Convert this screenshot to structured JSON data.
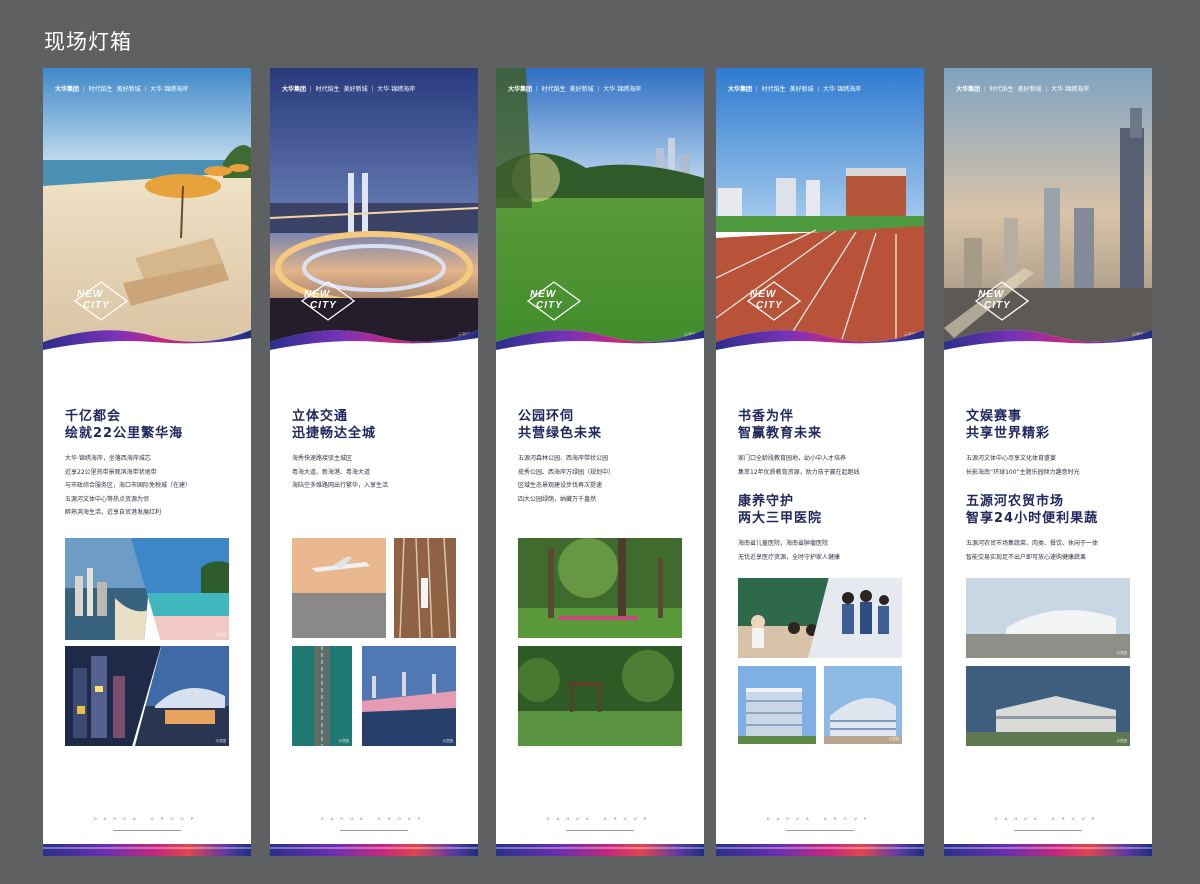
{
  "page": {
    "title": "现场灯箱"
  },
  "brand": {
    "logo_text": "大华集团",
    "logo_sub": "DAHUA GROUP",
    "slogan_1": "时代焰生",
    "slogan_2": "美好新城",
    "project": "大华·锦绣海岸",
    "newcity": [
      "NEW",
      "CITY"
    ],
    "footer": "DAHUA GROUP"
  },
  "panels": [
    {
      "headings": [
        {
          "title": [
            "千亿都会",
            "绘就22公里繁华海"
          ],
          "lines": [
            "大华·锦绣海岸，坐落西海岸城芯",
            "近享22公里热带景观滨海带状地带",
            "与市政综合服务区，海口市国际免税城（在建）",
            "五源河文体中心等热点资源为邻",
            "醉熟滨海生活，近享自贸港发展红利"
          ]
        }
      ]
    },
    {
      "headings": [
        {
          "title": [
            "立体交通",
            "迅捷畅达全城"
          ],
          "lines": [
            "海秀快速路接驳主城区",
            "粤海大道、新海港、粤海大道",
            "海陆空多维路网出行繁华，入享生活"
          ]
        }
      ]
    },
    {
      "headings": [
        {
          "title": [
            "公园环伺",
            "共营绿色未来"
          ],
          "lines": [
            "五源河森林公园、西海岸带状公园",
            "揽秀公园、西海岸万绿园（规划中）",
            "区域生态景观建设步伐再次提速",
            "四大公园绿荫，纳藏万千盎然"
          ]
        }
      ]
    },
    {
      "headings": [
        {
          "title": [
            "书香为伴",
            "智赢教育未来"
          ],
          "lines": [
            "家门口全龄段教育园地，幼小中入才培养",
            "集萃12年优质教育资源，助力孩子赢在起跑线"
          ]
        },
        {
          "title": [
            "康养守护",
            "两大三甲医院"
          ],
          "lines": [
            "海南省儿童医院，海南省肿瘤医院",
            "无忧近享医疗资源，全时守护家人健康"
          ]
        }
      ]
    },
    {
      "headings": [
        {
          "title": [
            "文娱赛事",
            "共享世界精彩"
          ],
          "lines": [
            "五源河文体中心尽享文化体育盛宴",
            "长影海南“环球100”主题乐园倾力趣意时光"
          ]
        },
        {
          "title": [
            "五源河农贸市场",
            "智享24小时便利果蔬"
          ],
          "lines": [
            "五源河农贸市场集蔬菜、肉类、餐饮、休闲于一体",
            "智能交易实现足不出户即可放心速购健康蔬果"
          ]
        }
      ]
    }
  ],
  "photo_credit": "示意图",
  "colors": {
    "heading": "#22285f",
    "background": "#5f6062",
    "accent_purple": "#6a2fb0",
    "accent_pink": "#c8287d"
  }
}
